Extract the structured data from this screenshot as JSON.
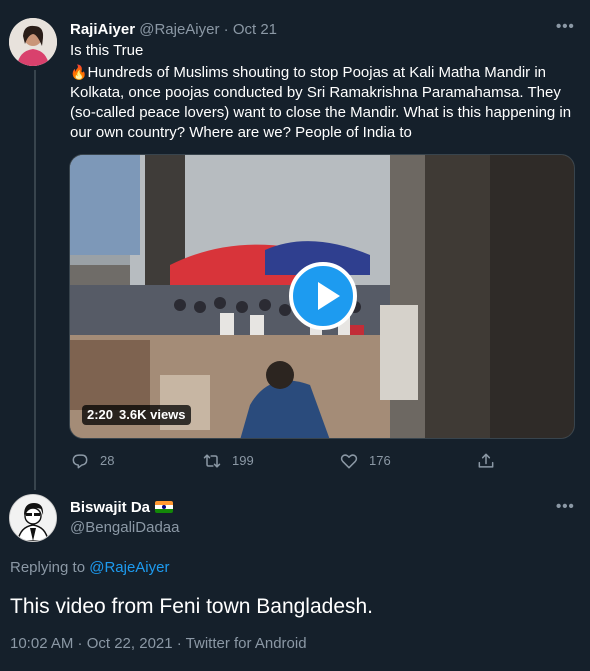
{
  "tweet": {
    "author_name": "RajiAiyer",
    "author_handle": "@RajeAiyer",
    "separator": "·",
    "date": "Oct 21",
    "text_line1": "Is this True",
    "fire_emoji": "🔥",
    "text_body": "Hundreds of Muslims shouting to stop Poojas at Kali Matha Mandir in Kolkata, once poojas conducted by Sri Ramakrishna Paramahamsa. They (so-called peace lovers) want to close the Mandir. What is this happening in our own country? Where are we? People of India to",
    "video": {
      "duration": "2:20",
      "views": "3.6K views"
    },
    "actions": {
      "replies": "28",
      "retweets": "199",
      "likes": "176"
    }
  },
  "reply": {
    "author_name": "Biswajit Da",
    "flag": "india-flag",
    "author_handle": "@BengaliDadaa",
    "replying_prefix": "Replying to",
    "replying_to": "@RajeAiyer",
    "text": "This video from Feni town Bangladesh.",
    "timestamp": "10:02 AM · Oct 22, 2021 · Twitter for Android"
  },
  "icons": {
    "more": "more-icon",
    "reply": "reply-icon",
    "retweet": "retweet-icon",
    "like": "like-icon",
    "share": "share-icon",
    "play": "play-icon"
  },
  "colors": {
    "background": "#15202b",
    "accent": "#1d9bf0",
    "muted": "#8b98a5",
    "divider": "#38444d"
  }
}
